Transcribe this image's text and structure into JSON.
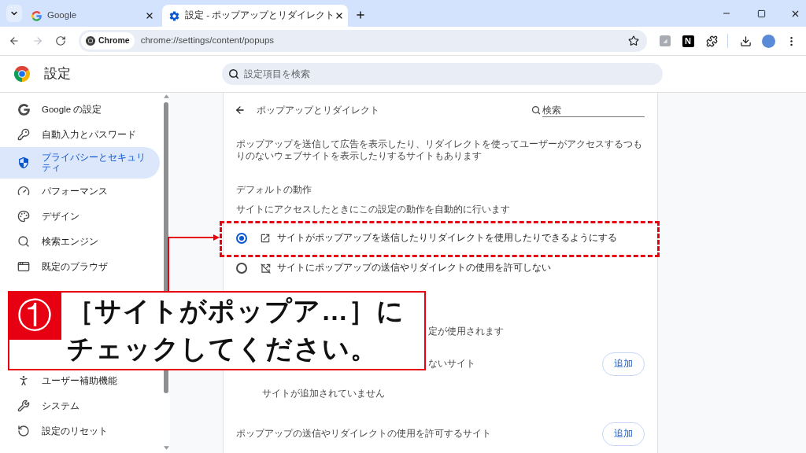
{
  "browser": {
    "tabs": [
      {
        "title": "Google",
        "kind": "google",
        "selected": false
      },
      {
        "title": "設定 - ポップアップとリダイレクト",
        "kind": "settings",
        "selected": true
      }
    ],
    "forward_disabled": true,
    "address_bar": {
      "chip": "Chrome",
      "url": "chrome://settings/content/popups"
    },
    "extension_letter": "N"
  },
  "settings_header": {
    "title": "設定",
    "search_placeholder": "設定項目を検索"
  },
  "sidebar": {
    "items_top": [
      {
        "label": "Google の設定",
        "kind": "google",
        "selected": false
      },
      {
        "label": "自動入力とパスワード",
        "kind": "autofill",
        "selected": false
      },
      {
        "label": "プライバシーとセキュリティ",
        "kind": "privacy",
        "selected": true
      },
      {
        "label": "パフォーマンス",
        "kind": "performance",
        "selected": false
      },
      {
        "label": "デザイン",
        "kind": "appearance",
        "selected": false
      },
      {
        "label": "検索エンジン",
        "kind": "search",
        "selected": false
      },
      {
        "label": "既定のブラウザ",
        "kind": "browser",
        "selected": false
      }
    ],
    "items_bottom": [
      {
        "label": "ユーザー補助機能",
        "kind": "accessibility",
        "selected": false
      },
      {
        "label": "システム",
        "kind": "system",
        "selected": false
      },
      {
        "label": "設定のリセット",
        "kind": "reset",
        "selected": false
      }
    ]
  },
  "content": {
    "title": "ポップアップとリダイレクト",
    "search_placeholder": "検索",
    "description": "ポップアップを送信して広告を表示したり、リダイレクトを使ってユーザーがアクセスするつもりのないウェブサイトを表示したりするサイトもあります",
    "default_heading": "デフォルトの動作",
    "default_subheading": "サイトにアクセスしたときにこの設定の動作を自動的に行います",
    "options": [
      {
        "label": "サイトがポップアップを送信したりリダイレクトを使用したりできるようにする",
        "kind": "allow",
        "selected": true
      },
      {
        "label": "サイトにポップアップの送信やリダイレクトの使用を許可しない",
        "kind": "block",
        "selected": false
      }
    ],
    "custom_description": "定が使用されます",
    "site_lists": [
      {
        "title": "ないサイト",
        "button": "追加",
        "empty_text": "サイトが追加されていません"
      },
      {
        "title": "ポップアップの送信やリダイレクトの使用を許可するサイト",
        "button": "追加"
      }
    ]
  },
  "callout": {
    "badge": "①",
    "text": "［サイトがポップア…］にチェックしてください。"
  }
}
